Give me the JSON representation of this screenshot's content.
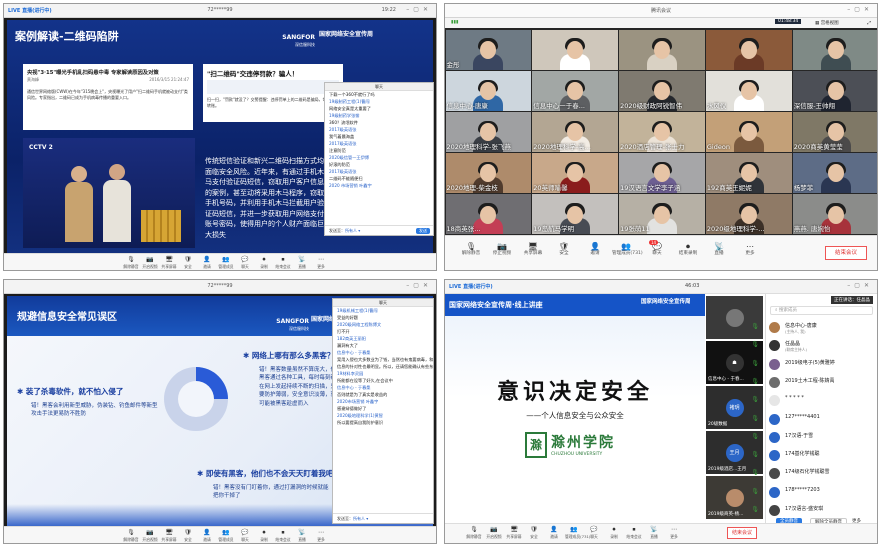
{
  "q1": {
    "window_title": "72*****99",
    "live": "LIVE 直播(进行中)",
    "time": "19:22",
    "slide": {
      "title": "案例解读-二维码陷阱",
      "logo_brand": "SANGFOR",
      "logo_sub": "深信服科技",
      "logo_right": "国家网络安全宣传周",
      "article_title": "央视\"3·15\"曝光手机乱扫码悬中毒 专家解读原因及对策",
      "article_meta": "黄海峰",
      "article_date": "2016/3/15 21:24:47",
      "article_body": "通信世界网络版(CWW)在今年\"315晚会上\"，央视曝光了用户\"扫二维码手机就被动支付\"类风险。专家指出，二维码已成为手机病毒传播的重要入口。",
      "tv_logo": "CCTV 2",
      "scan_title": "\"扫二维码\"交违停罚款？骗人！",
      "scan_body": "扫一扫，\"罚款\"就没了？交警提醒：违停罚单上的二维码是骗局，切勿扫码转账。",
      "body_text": "传统短信验证和新兴二维码扫描方式均面临安全风险。近年来，有通过手机木马支付验证码短信，窃取用户客户信息的案例，甚至动将采用木马程序，窃取手机号码，并利用手机木马拦截用户验证码短信，并进一步获取用户网络支付账号密码，使得用户的个人财产面临巨大损失"
    },
    "chat": {
      "title": "聊天",
      "messages": [
        {
          "t": "下载一个360不就行了吗",
          "n": false
        },
        {
          "t": "19级制药工程(1)曹闯",
          "n": true
        },
        {
          "t": "网络安全真是太重要了",
          "n": false
        },
        {
          "t": "19级制药学张愉",
          "n": true
        },
        {
          "t": "360？流氓软件",
          "n": false
        },
        {
          "t": "2017级英语张",
          "n": true
        },
        {
          "t": "我气着晨海盖",
          "n": false
        },
        {
          "t": "2017级英语张",
          "n": true
        },
        {
          "t": "注意防范",
          "n": false
        },
        {
          "t": "2020级信管一王伊博",
          "n": true
        },
        {
          "t": "好滚的防范",
          "n": false
        },
        {
          "t": "2017级英语张",
          "n": true
        },
        {
          "t": "二维码不能随便扫",
          "n": false
        },
        {
          "t": "2020 市场营销 叶鑫宇",
          "n": true
        }
      ],
      "to_label": "发送至：",
      "to_value": "所有人 ▾",
      "send": "发送"
    },
    "controls": [
      "解除静音",
      "开启视频",
      "共享屏幕",
      "安全",
      "邀请",
      "管理成员",
      "聊天",
      "录制",
      "结束会议",
      "直播",
      "更多"
    ]
  },
  "q2": {
    "app_title": "腾讯会议",
    "timer": "01:48:34",
    "view_label": "宫格视图",
    "live_label": "观看中",
    "tiles": [
      {
        "name": "金彤",
        "bg": "#6e7a84",
        "shirt": "#3a4660"
      },
      {
        "name": "",
        "bg": "#cfc7bb",
        "shirt": "#ffffff"
      },
      {
        "name": "",
        "bg": "#9b9381",
        "shirt": "#d9d1c3"
      },
      {
        "name": "",
        "bg": "#8b5a3a",
        "shirt": "#6b3a26"
      },
      {
        "name": "",
        "bg": "#7f8a86",
        "shirt": "#3f4d52"
      },
      {
        "name": "信息中心-唐康",
        "bg": "#cdd6dd",
        "shirt": "#2f67a5"
      },
      {
        "name": "信息中心一于春...",
        "bg": "#a2a7a5",
        "shirt": "#5d5f62"
      },
      {
        "name": "2020级财政阿锐智伟",
        "bg": "#7f7a70",
        "shirt": "#25282d"
      },
      {
        "name": "水风仪",
        "bg": "#e2e0da",
        "shirt": "#ffffff"
      },
      {
        "name": "深信服-王帅翔",
        "bg": "#4c4f56",
        "shirt": "#1f2430"
      },
      {
        "name": "2020地理科学-张飞燕",
        "bg": "#9fa0a2",
        "shirt": "#3a3e45"
      },
      {
        "name": "2020地理科学-高...",
        "bg": "#b3a693",
        "shirt": "#f2ece4"
      },
      {
        "name": "2020酒店管理-张士力",
        "bg": "#c2b39a",
        "shirt": "#ece3d7"
      },
      {
        "name": "Gideon",
        "bg": "#c3a078",
        "shirt": "#7b5a3e"
      },
      {
        "name": "2020商英黄莹莹",
        "bg": "#7f7866",
        "shirt": "#4b4a4a"
      },
      {
        "name": "2020地理-柴金枝",
        "bg": "#ae8b6b",
        "shirt": "#503b2d"
      },
      {
        "name": "20英师喻馨",
        "bg": "#c8a88a",
        "shirt": "#8a1c1c"
      },
      {
        "name": "19汉语言文学李子涵",
        "bg": "#a6a6a8",
        "shirt": "#6d5f92"
      },
      {
        "name": "192商英王妮妮",
        "bg": "#9f8e7d",
        "shirt": "#2f3339"
      },
      {
        "name": "杨梦菲",
        "bg": "#5d6c86",
        "shirt": "#2a3652"
      },
      {
        "name": "18商英张...",
        "bg": "#6f6e72",
        "shirt": "#c33e55"
      },
      {
        "name": "19岛航马学明",
        "bg": "#c3c0bd",
        "shirt": "#484c54"
      },
      {
        "name": "19张萌11",
        "bg": "#b6b0a5",
        "shirt": "#e2e2e0"
      },
      {
        "name": "2020级地理科学-...",
        "bg": "#8f7a66",
        "shirt": "#3c3027"
      },
      {
        "name": "燕燕. 唐婉怡",
        "bg": "#8b8c8a",
        "shirt": "#a7323b"
      }
    ],
    "bottom_names": [
      "曲小倩",
      "",
      "",
      ""
    ],
    "controls": [
      "解除静音",
      "停止视频",
      "共享屏幕",
      "安全",
      "邀请",
      "管理成员(731)",
      "聊天",
      "结束录制",
      "直播",
      "更多"
    ],
    "chat_badge": "14",
    "end": "结束会议"
  },
  "q3": {
    "window_title": "72*****99",
    "slide": {
      "title": "规避信息安全常见误区",
      "logo_brand": "SANGFOR",
      "logo_sub": "深信服科技",
      "logo_right": "国家网络安全宣传周",
      "item1_title": "装了杀毒软件，就不怕入侵了",
      "item1_body": "错！黑客会利用新型威胁，伪装钻、钓鱼邮件等新型攻击手法更易防不胜防",
      "item2_title": "网络上哪有那么多黑客？",
      "item2_body": "错！黑客数量虽然不算庞大，但黑客通过各种工具，每时每刻都在网上发起持续不断的扫描，只要防护薄弱，安全意识淡薄，就可能被黑客趁虚而入",
      "item3_title": "即使有黑客，他们也不会天天盯着我吧？",
      "item3_body": "错！黑客没有门盯着你，通过打漏洞的时候就能把你干掉了"
    },
    "chat": {
      "title": "聊天",
      "messages": [
        {
          "t": "19级机械工程(1)曹闯",
          "n": true
        },
        {
          "t": "受益的好题",
          "n": false
        },
        {
          "t": "2020级网络工程陈博文",
          "n": true
        },
        {
          "t": "打不开",
          "n": false
        },
        {
          "t": "182商英王丽阳",
          "n": true
        },
        {
          "t": "漏洞有大了",
          "n": false
        },
        {
          "t": "信息中心 - 于春桑",
          "n": true
        },
        {
          "t": "案用入侵也大多数业为了钱，当然也有鬼要病毒，和",
          "n": false
        },
        {
          "t": "信息的针对性也最明显。所以，还请您能确认有些东西",
          "n": false
        },
        {
          "t": "19材料李灵园",
          "n": true
        },
        {
          "t": "所能都在设等了好久,在会议中",
          "n": false
        },
        {
          "t": "信息中心 - 于春桑",
          "n": true
        },
        {
          "t": "否则就是为了真实是收益的",
          "n": false
        },
        {
          "t": "2020市场营销 叶鑫宇",
          "n": true
        },
        {
          "t": "感谢辩德做好了",
          "n": false
        },
        {
          "t": "2020级地理科学(1)黄智",
          "n": true
        },
        {
          "t": "所以要提高自我防护意识",
          "n": false
        }
      ],
      "to_label": "发送至：",
      "to_value": "所有人 ▾",
      "send": "发送"
    },
    "controls": [
      "解除静音",
      "开启视频",
      "共享屏幕",
      "安全",
      "邀请",
      "管理成员",
      "聊天",
      "录制",
      "结束会议",
      "直播",
      "更多"
    ]
  },
  "q4": {
    "live": "LIVE 直播(进行中)",
    "time": "46:03",
    "banner": "国家网络安全宣传周·线上讲座",
    "logo_right": "国家网络安全宣传周",
    "main_title": "意识决定安全",
    "subtitle": "——个人信息安全与公众安全",
    "university_cn": "滁州学院",
    "university_en": "CHUZHOU UNIVERSITY",
    "speaker_label": "正在讲话：任晶晶",
    "search_placeholder": "搜索成员",
    "thumbs": [
      {
        "name": "",
        "bg": "#3a3a3a",
        "av": "",
        "avbg": "#777"
      },
      {
        "name": "信息中心 - 于春...",
        "bg": "#111",
        "av": "☗",
        "avbg": "#333"
      },
      {
        "name": "20级数据",
        "bg": "#2d2d2d",
        "av": "褚玥",
        "avbg": "#2c66c7"
      },
      {
        "name": "2019级酒店...王月",
        "bg": "#2d2d2d",
        "av": "王月",
        "avbg": "#2c66c7"
      },
      {
        "name": "2019级商英-杨...",
        "bg": "#3d3a35",
        "av": "",
        "avbg": "#b98c6b"
      }
    ],
    "members": [
      {
        "name": "信息中心-唐康",
        "sub": "(主持人, 我)",
        "av": "#b07b4a"
      },
      {
        "name": "任晶晶",
        "sub": "(联席主持人)",
        "av": "#333"
      },
      {
        "name": "2019级电子(5)黄雅婷",
        "sub": "",
        "av": "#7a5f8f"
      },
      {
        "name": "2019土木工程-陈婧禹",
        "sub": "",
        "av": "#6d6d6d"
      },
      {
        "name": "* * * * *",
        "sub": "",
        "av": "#e6e6e6"
      },
      {
        "name": "127*****4401",
        "sub": "",
        "av": "#2c66c7"
      },
      {
        "name": "17汉语-于雪",
        "sub": "",
        "av": "#2c66c7"
      },
      {
        "name": "174基化学钱聪",
        "sub": "",
        "av": "#2c66c7"
      },
      {
        "name": "174级石化学钱聪雪",
        "sub": "",
        "av": "#4a4a4a"
      },
      {
        "name": "178*****7203",
        "sub": "",
        "av": "#2c66c7"
      },
      {
        "name": "17汉语言-盛安琪",
        "sub": "",
        "av": "#444"
      }
    ],
    "footer_buttons": [
      "全员静音",
      "解除全员静音",
      "更多"
    ],
    "controls": [
      "解除静音",
      "开启视频",
      "共享屏幕",
      "安全",
      "邀请",
      "管理成员(731)",
      "聊天",
      "录制",
      "结束会议",
      "直播",
      "更多"
    ],
    "end": "结束会议"
  }
}
